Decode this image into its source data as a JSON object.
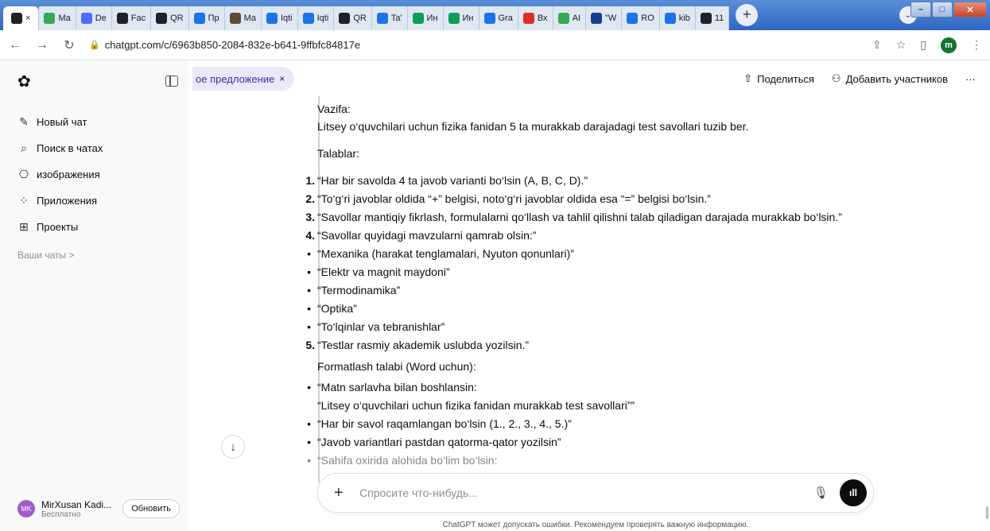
{
  "browser": {
    "tabs": [
      {
        "label": "",
        "icon": "openai-icon",
        "color": "#202124",
        "active": true
      },
      {
        "label": "Ma",
        "icon": "leaf-icon",
        "color": "#34a853"
      },
      {
        "label": "De",
        "icon": "deepseek-icon",
        "color": "#4d6bfe"
      },
      {
        "label": "Fac",
        "icon": "slash-icon",
        "color": "#202124"
      },
      {
        "label": "QR",
        "icon": "openai-icon",
        "color": "#202124"
      },
      {
        "label": "Пр",
        "icon": "tile-icon",
        "color": "#1a73e8"
      },
      {
        "label": "Ma",
        "icon": "circle-icon",
        "color": "#5f4b32"
      },
      {
        "label": "Iqti",
        "icon": "g-icon",
        "color": "#1a73e8"
      },
      {
        "label": "Iqti",
        "icon": "g-icon",
        "color": "#1a73e8"
      },
      {
        "label": "QR",
        "icon": "openai-icon",
        "color": "#202124"
      },
      {
        "label": "Ta'",
        "icon": "g-icon",
        "color": "#1a73e8"
      },
      {
        "label": "Ин",
        "icon": "shield-icon",
        "color": "#0f9d58"
      },
      {
        "label": "Ин",
        "icon": "shield-icon",
        "color": "#0f9d58"
      },
      {
        "label": "Gra",
        "icon": "bars-icon",
        "color": "#1a73e8"
      },
      {
        "label": "Вх",
        "icon": "gmail-icon",
        "color": "#d93025"
      },
      {
        "label": "AI",
        "icon": "chart-icon",
        "color": "#34a853"
      },
      {
        "label": "\"W",
        "icon": "h-icon",
        "color": "#1a3e8c"
      },
      {
        "label": "RO",
        "icon": "w-icon",
        "color": "#1a73e8"
      },
      {
        "label": "kib",
        "icon": "diamond-icon",
        "color": "#1a73e8"
      },
      {
        "label": "11",
        "icon": "openai-icon",
        "color": "#202124"
      }
    ],
    "new_tab": "+",
    "url": "chatgpt.com/c/6963b850-2084-832e-b641-9ffbfc84817e",
    "profile_initial": "m"
  },
  "sidebar": {
    "items": [
      {
        "label": "Новый чат",
        "icon": "edit-icon",
        "glyph": "✎"
      },
      {
        "label": "Поиск в чатах",
        "icon": "search-icon",
        "glyph": "⌕"
      },
      {
        "label": "изображения",
        "icon": "images-icon",
        "glyph": "⎔"
      },
      {
        "label": "Приложения",
        "icon": "apps-icon",
        "glyph": "⁘"
      },
      {
        "label": "Проекты",
        "icon": "folder-icon",
        "glyph": "⊞"
      }
    ],
    "section_label": "Ваши чаты >",
    "user": {
      "initials": "MK",
      "name": "MirXusan Kadi...",
      "plan": "Бесплатно",
      "upgrade_label": "Обновить"
    }
  },
  "header": {
    "chip_label": "ое предложение",
    "chip_close": "×",
    "share_label": "Поделиться",
    "add_members_label": "Добавить участников",
    "more": "···"
  },
  "message": {
    "task_heading": "Vazifa:",
    "task_text": "Litsey o‘quvchilari uchun fizika fanidan 5 ta murakkab darajadagi test savollari tuzib ber.",
    "req_heading": "Talablar:",
    "req_items": [
      {
        "marker": "1.",
        "text": "“Har bir savolda 4 ta javob varianti bo‘lsin (A, B, C, D).”"
      },
      {
        "marker": "2.",
        "text": "“To‘g‘ri javoblar oldida “+” belgisi, noto‘g‘ri javoblar oldida esa “=” belgisi bo‘lsin.”"
      },
      {
        "marker": "3.",
        "text": "“Savollar mantiqiy fikrlash, formulalarni qo‘llash va tahlil qilishni talab qiladigan darajada murakkab bo‘lsin.”"
      },
      {
        "marker": "4.",
        "text": "“Savollar quyidagi mavzularni qamrab olsin:”"
      },
      {
        "marker": "•",
        "text": "“Mexanika (harakat tenglamalari, Nyuton qonunlari)”"
      },
      {
        "marker": "•",
        "text": "“Elektr va magnit maydoni”"
      },
      {
        "marker": "•",
        "text": "“Termodinamika”"
      },
      {
        "marker": "•",
        "text": "“Optika”"
      },
      {
        "marker": "•",
        "text": "“To‘lqinlar va tebranishlar”"
      },
      {
        "marker": "5.",
        "text": "“Testlar rasmiy akademik uslubda yozilsin.”"
      }
    ],
    "format_heading": "Formatlash talabi (Word uchun):",
    "format_items": [
      {
        "marker": "•",
        "text": "“Matn sarlavha bilan boshlansin:"
      },
      {
        "marker": "",
        "text": "“Litsey o‘quvchilari uchun fizika fanidan murakkab test savollari””"
      },
      {
        "marker": "•",
        "text": "“Har bir savol raqamlangan bo‘lsin (1., 2., 3., 4., 5.)”"
      },
      {
        "marker": "•",
        "text": "“Javob variantlari pastdan qatorma-qator yozilsin”"
      },
      {
        "marker": "•",
        "text": "“Sahifa oxirida alohida bo‘lim bo‘lsin:"
      }
    ]
  },
  "composer": {
    "placeholder": "Спросите что-нибудь...",
    "plus": "+",
    "disclaimer": "ChatGPT может допускать ошибки. Рекомендуем проверять важную информацию."
  }
}
